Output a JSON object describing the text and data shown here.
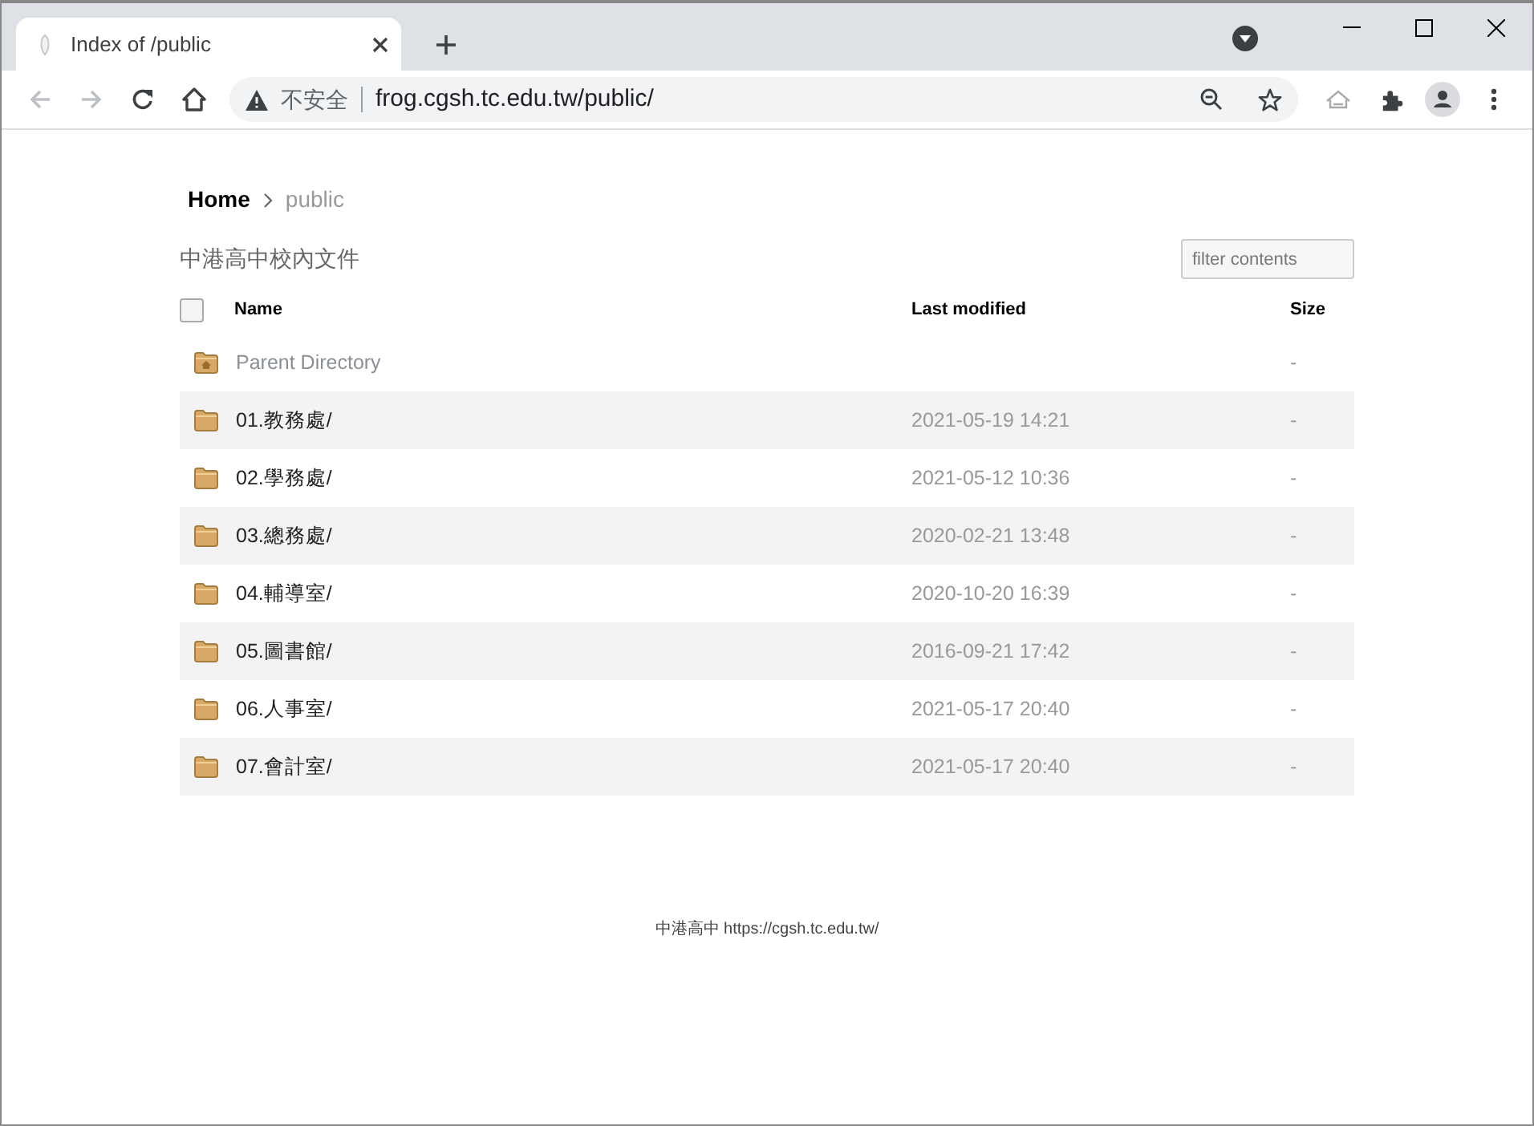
{
  "browser": {
    "tab_title": "Index of /public",
    "security_label": "不安全",
    "url": "frog.cgsh.tc.edu.tw/public/"
  },
  "breadcrumb": [
    {
      "label": "Home",
      "selected": false
    },
    {
      "label": "public",
      "selected": true
    }
  ],
  "heading": "中港高中校內文件",
  "filter": {
    "placeholder": "filter contents"
  },
  "select_all": {
    "checked": false
  },
  "columns": [
    "Name",
    "Last modified",
    "Size"
  ],
  "rows": [
    {
      "kind": "parent",
      "name": "Parent Directory",
      "size": "-"
    },
    {
      "kind": "folder",
      "name": "01.教務處/",
      "modified": "2021-05-19 14:21",
      "size": "-"
    },
    {
      "kind": "folder",
      "name": "02.學務處/",
      "modified": "2021-05-12 10:36",
      "size": "-"
    },
    {
      "kind": "folder",
      "name": "03.總務處/",
      "modified": "2020-02-21 13:48",
      "size": "-"
    },
    {
      "kind": "folder",
      "name": "04.輔導室/",
      "modified": "2020-10-20 16:39",
      "size": "-"
    },
    {
      "kind": "folder",
      "name": "05.圖書館/",
      "modified": "2016-09-21 17:42",
      "size": "-"
    },
    {
      "kind": "folder",
      "name": "06.人事室/",
      "modified": "2021-05-17 20:40",
      "size": "-"
    },
    {
      "kind": "folder",
      "name": "07.會計室/",
      "modified": "2021-05-17 20:40",
      "size": "-"
    }
  ],
  "footer": "中港高中 https://cgsh.tc.edu.tw/"
}
